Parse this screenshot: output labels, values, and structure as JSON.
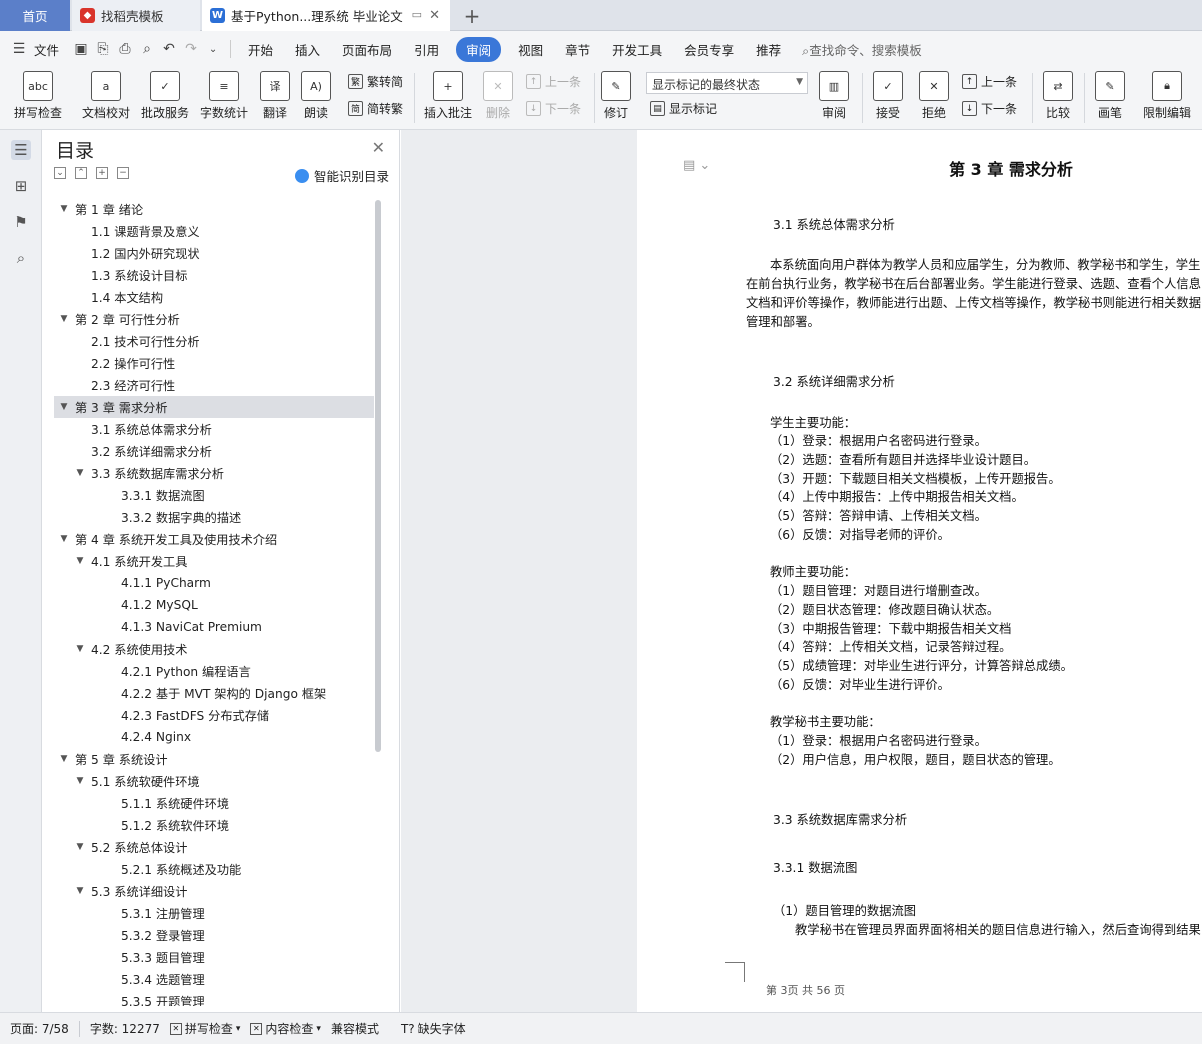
{
  "tabs": {
    "home": "首页",
    "template": "找稻壳模板",
    "document": "基于Python...理系统 毕业论文",
    "add": "+"
  },
  "menu": {
    "file": "文件",
    "items": [
      "开始",
      "插入",
      "页面布局",
      "引用",
      "审阅",
      "视图",
      "章节",
      "开发工具",
      "会员专享",
      "推荐"
    ],
    "active": "审阅",
    "search": "查找命令、搜索模板"
  },
  "ribbon": {
    "spell": "拼写检查",
    "proof": "文档校对",
    "batch": "批改服务",
    "wordcount": "字数统计",
    "translate": "翻译",
    "read": "朗读",
    "trad_to_simp": "繁转简",
    "simp_to_trad": "简转繁",
    "insert_comment": "插入批注",
    "delete": "删除",
    "prev": "上一条",
    "next": "下一条",
    "revise": "修订",
    "markup_state": "显示标记的最终状态",
    "show_markup": "显示标记",
    "review": "审阅",
    "accept": "接受",
    "reject": "拒绝",
    "prev2": "上一条",
    "next2": "下一条",
    "compare": "比较",
    "pen": "画笔",
    "restrict": "限制编辑"
  },
  "toc": {
    "title": "目录",
    "ai_label": "智能识别目录",
    "items": [
      {
        "label": "第 1 章  绪论",
        "level": 1,
        "expand": true
      },
      {
        "label": "1.1  课题背景及意义",
        "level": 2
      },
      {
        "label": "1.2  国内外研究现状",
        "level": 2
      },
      {
        "label": "1.3 系统设计目标",
        "level": 2
      },
      {
        "label": "1.4  本文结构",
        "level": 2
      },
      {
        "label": "第 2 章  可行性分析",
        "level": 1,
        "expand": true
      },
      {
        "label": "2.1  技术可行性分析",
        "level": 2
      },
      {
        "label": "2.2  操作可行性",
        "level": 2
      },
      {
        "label": "2.3  经济可行性",
        "level": 2
      },
      {
        "label": "第 3 章  需求分析",
        "level": 1,
        "expand": true,
        "selected": true
      },
      {
        "label": "3.1 系统总体需求分析",
        "level": 2
      },
      {
        "label": "3.2 系统详细需求分析",
        "level": 2
      },
      {
        "label": "3.3  系统数据库需求分析",
        "level": 2,
        "expand": true
      },
      {
        "label": "3.3.1  数据流图",
        "level": 3
      },
      {
        "label": "3.3.2 数据字典的描述",
        "level": 3
      },
      {
        "label": "第 4 章  系统开发工具及使用技术介绍",
        "level": 1,
        "expand": true
      },
      {
        "label": "4.1  系统开发工具",
        "level": 2,
        "expand": true
      },
      {
        "label": "4.1.1 PyCharm",
        "level": 3
      },
      {
        "label": "4.1.2 MySQL",
        "level": 3
      },
      {
        "label": "4.1.3 NaviCat Premium",
        "level": 3
      },
      {
        "label": "4.2  系统使用技术",
        "level": 2,
        "expand": true
      },
      {
        "label": "4.2.1 Python 编程语言",
        "level": 3
      },
      {
        "label": "4.2.2 基于 MVT 架构的 Django 框架",
        "level": 3
      },
      {
        "label": "4.2.3 FastDFS 分布式存储",
        "level": 3
      },
      {
        "label": "4.2.4 Nginx",
        "level": 3
      },
      {
        "label": "第 5 章  系统设计",
        "level": 1,
        "expand": true
      },
      {
        "label": "5.1 系统软硬件环境",
        "level": 2,
        "expand": true
      },
      {
        "label": "5.1.1  系统硬件环境",
        "level": 3
      },
      {
        "label": "5.1.2  系统软件环境",
        "level": 3
      },
      {
        "label": "5.2 系统总体设计",
        "level": 2,
        "expand": true
      },
      {
        "label": "5.2.1 系统概述及功能",
        "level": 3
      },
      {
        "label": "5.3 系统详细设计",
        "level": 2,
        "expand": true
      },
      {
        "label": "5.3.1  注册管理",
        "level": 3
      },
      {
        "label": "5.3.2  登录管理",
        "level": 3
      },
      {
        "label": "5.3.3  题目管理",
        "level": 3
      },
      {
        "label": "5.3.4  选题管理",
        "level": 3
      },
      {
        "label": "5.3.5  开题管理",
        "level": 3
      }
    ]
  },
  "document": {
    "chapter_title": "第 3 章  需求分析",
    "lines": [
      "3.1 系统总体需求分析",
      "本系统面向用户群体为教学人员和应届学生，分为教师、教学秘书和学生，学生",
      "在前台执行业务，教学秘书在后台部署业务。学生能进行登录、选题、查看个人信息",
      "文档和评价等操作，教师能进行出题、上传文档等操作，教学秘书则能进行相关数据",
      "管理和部署。",
      "3.2 系统详细需求分析",
      "学生主要功能：",
      "（1）登录：根据用户名密码进行登录。",
      "（2）选题：查看所有题目并选择毕业设计题目。",
      "（3）开题：下载题目相关文档模板，上传开题报告。",
      "（4）上传中期报告：上传中期报告相关文档。",
      "（5）答辩：答辩申请、上传相关文档。",
      "（6）反馈：对指导老师的评价。",
      "教师主要功能：",
      "（1）题目管理：对题目进行增删查改。",
      "（2）题目状态管理：修改题目确认状态。",
      "（3）中期报告管理：下载中期报告相关文档",
      "（4）答辩：上传相关文档，记录答辩过程。",
      "（5）成绩管理：对毕业生进行评分，计算答辩总成绩。",
      "（6）反馈：对毕业生进行评价。",
      "教学秘书主要功能：",
      "（1）登录：根据用户名密码进行登录。",
      "（2）用户信息，用户权限，题目，题目状态的管理。",
      "3.3  系统数据库需求分析",
      "3.3.1  数据流图",
      "（1）题目管理的数据流图",
      "教学秘书在管理员界面界面将相关的题目信息进行输入，然后查询得到结果"
    ],
    "page_footer": "第 3页  共 56 页"
  },
  "status": {
    "page": "页面: 7/58",
    "words": "字数: 12277",
    "spell": "拼写检查",
    "content_check": "内容检查",
    "compat": "兼容模式",
    "missing_font": "缺失字体"
  },
  "colors": {
    "accent": "#3a77d8",
    "home_tab": "#5b7fc9"
  }
}
